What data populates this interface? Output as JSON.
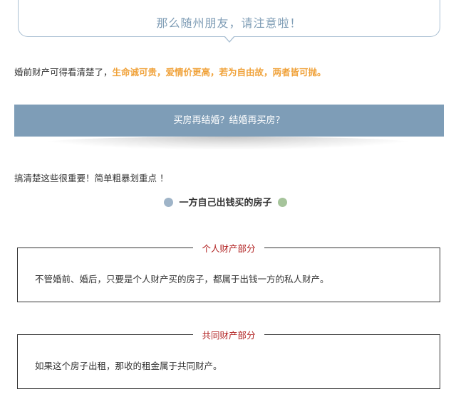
{
  "callout": {
    "text": "那么随州朋友，请注意啦！"
  },
  "intro": {
    "text": "婚前财产可得看清楚了，",
    "highlight": "生命诚可贵，爱情价更高，若为自由故，两者皆可抛。"
  },
  "banner": {
    "text": "买房再结婚？结婚再买房？"
  },
  "subtitle": {
    "text": "搞清楚这些很重要！简单粗暴划重点 ！"
  },
  "dot_heading": {
    "text": "一方自己出钱买的房子"
  },
  "sections": [
    {
      "title": "个人财产部分",
      "body": "不管婚前、婚后，只要是个人财产买的房子，都属于出钱一方的私人财产。"
    },
    {
      "title": "共同财产部分",
      "body": "如果这个房子出租，那收的租金属于共同财产。"
    }
  ],
  "colors": {
    "accent_blue": "#7e9db7",
    "highlight_orange": "#f0a23a",
    "section_title_red": "#b01f1f",
    "dot_blue": "#9fb4c8",
    "dot_green": "#a6c49b"
  }
}
